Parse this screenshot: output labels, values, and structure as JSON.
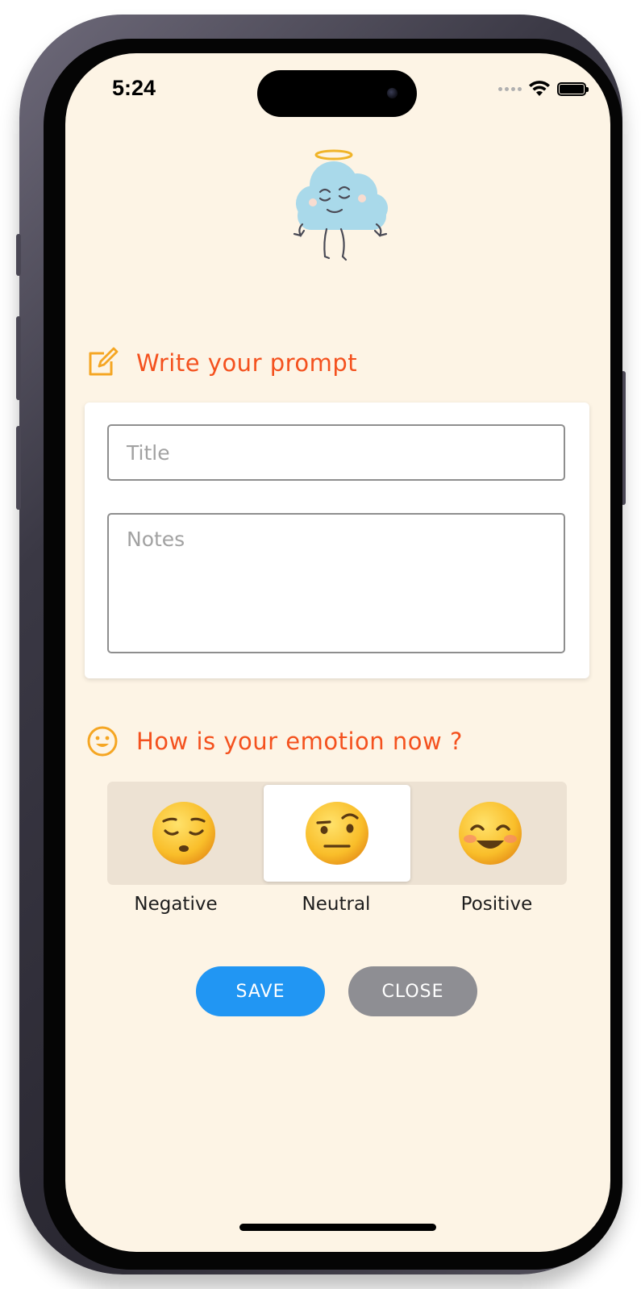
{
  "status_bar": {
    "time": "5:24"
  },
  "prompt_section": {
    "heading": "Write your prompt",
    "icon": "edit-note-icon",
    "title_placeholder": "Title",
    "notes_placeholder": "Notes"
  },
  "emotion_section": {
    "heading": "How is your emotion now ?",
    "icon": "smiley-icon",
    "options": [
      {
        "label": "Negative",
        "icon": "pensive-face-icon",
        "selected": false
      },
      {
        "label": "Neutral",
        "icon": "raised-eyebrow-face-icon",
        "selected": true
      },
      {
        "label": "Positive",
        "icon": "smiling-face-icon",
        "selected": false
      }
    ]
  },
  "actions": {
    "save_label": "SAVE",
    "close_label": "CLOSE"
  },
  "colors": {
    "background": "#fdf4e5",
    "accent_heading": "#f4511e",
    "icon_orange": "#f5a623",
    "save_button": "#2196f3",
    "close_button": "#8e8e93",
    "segment_bg": "#ede2d3"
  }
}
